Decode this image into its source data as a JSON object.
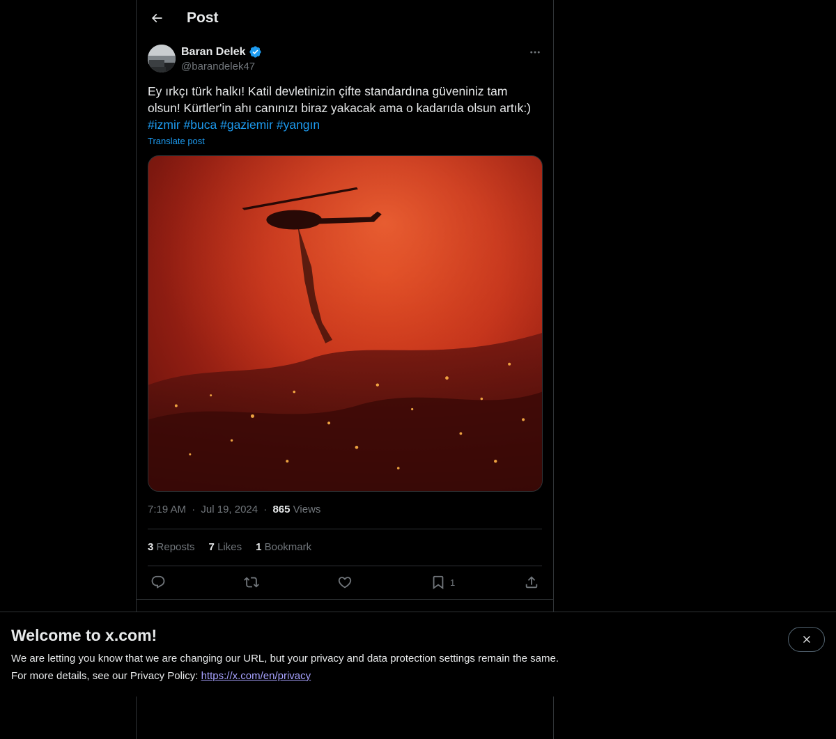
{
  "header": {
    "title": "Post"
  },
  "author": {
    "display_name": "Baran Delek",
    "handle": "@barandelek47"
  },
  "post": {
    "text": "Ey ırkçı türk halkı! Katil devletinizin çifte standardına güveniniz tam olsun! Kürtler'in ahı canınızı biraz yakacak ama o kadarıda olsun artık:)",
    "hashtags": [
      "#izmir",
      "#buca",
      "#gaziemir",
      "#yangın"
    ],
    "translate_label": "Translate post"
  },
  "meta": {
    "time": "7:19 AM",
    "separator": "·",
    "date": "Jul 19, 2024",
    "views_count": "865",
    "views_label": "Views"
  },
  "stats": {
    "reposts_count": "3",
    "reposts_label": "Reposts",
    "likes_count": "7",
    "likes_label": "Likes",
    "bookmarks_count": "1",
    "bookmarks_label": "Bookmark"
  },
  "actions": {
    "bookmark_count": "1"
  },
  "banner": {
    "title": "Welcome to x.com!",
    "line1": "We are letting you know that we are changing our URL, but your privacy and data protection settings remain the same.",
    "line2_prefix": "For more details, see our Privacy Policy: ",
    "link": "https://x.com/en/privacy"
  },
  "icons": {
    "back": "back-arrow-icon",
    "verified": "verified-badge-icon",
    "more": "more-dots-icon",
    "reply": "reply-icon",
    "repost": "repost-icon",
    "like": "heart-icon",
    "bookmark": "bookmark-icon",
    "share": "share-icon",
    "close": "close-icon"
  },
  "colors": {
    "accent": "#1d9bf0",
    "background": "#000000",
    "text": "#e7e9ea",
    "muted": "#71767b",
    "border": "#2f3336",
    "link_visited": "#a7a2ff"
  }
}
